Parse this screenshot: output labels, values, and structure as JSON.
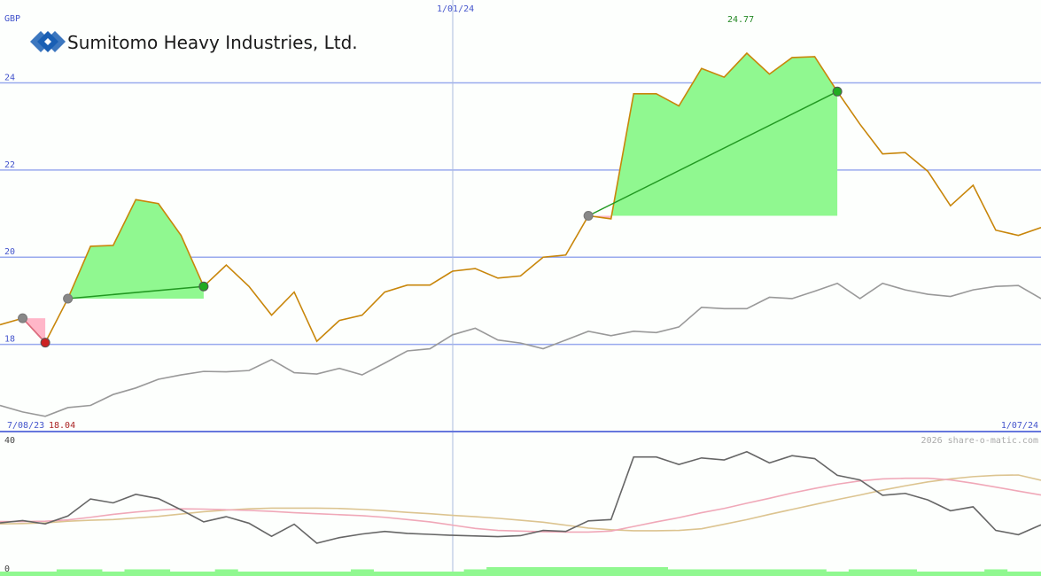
{
  "brand": {
    "name": "Sumitomo Heavy Industries, Ltd.",
    "logo_icon": "sumitomo-diamond-icon"
  },
  "labels": {
    "currency": "GBP",
    "date_start": "7/08/23",
    "date_mid": "1/01/24",
    "date_end": "1/07/24",
    "low_value": "18.04",
    "high_value": "24.77",
    "watermark": "2026 share-o-matic.com",
    "lower_top": "40",
    "lower_bottom": "0"
  },
  "colors": {
    "price": "#c8860a",
    "relative": "#999999",
    "gain_fill": "#90f890",
    "loss_fill": "#ffb6c8",
    "trend_line": "#229922",
    "grid": "#99aaee",
    "axis_text": "#4455cc",
    "high_text": "#228822",
    "low_text": "#aa2222",
    "osc_dark": "#666666",
    "osc_pink": "#f0a8b8",
    "osc_tan": "#dcc490",
    "volume": "#90f890"
  },
  "chart_data": {
    "type": "line",
    "title": "Sumitomo Heavy Industries, Ltd.",
    "ylabel": "GBP",
    "ylim": [
      16.0,
      25.9
    ],
    "yticks": [
      18,
      20,
      22,
      24
    ],
    "x_labels": [
      "7/08/23",
      "1/01/24",
      "1/07/24"
    ],
    "grid": true,
    "series": [
      {
        "name": "price",
        "values": [
          18.45,
          18.6,
          18.04,
          19.05,
          20.25,
          20.27,
          21.32,
          21.23,
          20.5,
          19.33,
          19.82,
          19.33,
          18.67,
          19.2,
          18.07,
          18.55,
          18.67,
          19.2,
          19.36,
          19.36,
          19.68,
          19.74,
          19.52,
          19.57,
          20.0,
          20.05,
          20.95,
          20.88,
          23.75,
          23.75,
          23.47,
          24.33,
          24.13,
          24.68,
          24.2,
          24.58,
          24.6,
          23.8,
          23.05,
          22.37,
          22.4,
          21.97,
          21.18,
          21.65,
          20.62,
          20.5,
          20.68
        ]
      },
      {
        "name": "relative",
        "values": [
          16.6,
          16.45,
          16.35,
          16.55,
          16.6,
          16.85,
          17.0,
          17.2,
          17.3,
          17.38,
          17.37,
          17.4,
          17.65,
          17.35,
          17.32,
          17.45,
          17.3,
          17.57,
          17.85,
          17.9,
          18.22,
          18.37,
          18.1,
          18.03,
          17.9,
          18.1,
          18.3,
          18.2,
          18.3,
          18.27,
          18.4,
          18.85,
          18.82,
          18.82,
          19.08,
          19.05,
          19.22,
          19.4,
          19.05,
          19.4,
          19.25,
          19.15,
          19.1,
          19.25,
          19.33,
          19.35,
          19.05
        ]
      }
    ],
    "annotations": {
      "low": 18.04,
      "high": 24.77,
      "trades": [
        {
          "buy": 18.6,
          "sell": 18.04,
          "result": "loss"
        },
        {
          "buy": 19.05,
          "sell": 19.33,
          "result": "gain"
        },
        {
          "buy": 20.95,
          "sell": 23.8,
          "result": "gain"
        }
      ]
    },
    "oscillator": {
      "ylim": [
        0,
        40
      ],
      "dark": [
        13.5,
        14.2,
        13.2,
        15.6,
        20.8,
        19.6,
        22.2,
        20.9,
        17.5,
        13.8,
        15.4,
        13.4,
        9.4,
        13.1,
        7.3,
        9.0,
        10.1,
        10.9,
        10.3,
        10.0,
        9.7,
        9.5,
        9.3,
        9.6,
        11.2,
        10.9,
        14.1,
        14.5,
        33.6,
        33.6,
        31.3,
        33.3,
        32.7,
        35.2,
        31.8,
        34.0,
        33.1,
        28.0,
        26.6,
        21.9,
        22.5,
        20.5,
        17.2,
        18.4,
        11.2,
        9.9,
        12.9
      ],
      "pink": [
        13.9,
        13.9,
        14.0,
        14.4,
        15.2,
        16.1,
        16.8,
        17.4,
        17.8,
        17.7,
        17.5,
        17.3,
        17.0,
        16.6,
        16.3,
        16.0,
        15.7,
        15.2,
        14.5,
        13.8,
        12.8,
        11.8,
        11.2,
        11.0,
        10.8,
        10.7,
        10.7,
        11.0,
        12.4,
        13.8,
        15.1,
        16.6,
        17.9,
        19.5,
        21.0,
        22.6,
        24.0,
        25.3,
        26.3,
        26.9,
        27.1,
        27.1,
        26.6,
        25.6,
        24.4,
        23.2,
        22.0
      ],
      "tan": [
        13.2,
        13.3,
        13.5,
        14.0,
        14.3,
        14.5,
        15.0,
        15.5,
        16.2,
        16.9,
        17.4,
        17.8,
        18.0,
        18.0,
        18.0,
        17.9,
        17.6,
        17.2,
        16.7,
        16.3,
        15.8,
        15.4,
        14.9,
        14.3,
        13.7,
        12.8,
        11.9,
        11.4,
        11.1,
        11.1,
        11.2,
        11.7,
        13.1,
        14.5,
        16.1,
        17.6,
        19.1,
        20.6,
        22.0,
        23.5,
        24.8,
        26.0,
        26.9,
        27.6,
        28.0,
        28.1,
        26.5
      ]
    },
    "volume": [
      2,
      2,
      2,
      3,
      3,
      2,
      3,
      3,
      2,
      2,
      3,
      2,
      2,
      2,
      2,
      2,
      3,
      2,
      2,
      2,
      2,
      3,
      4,
      4,
      4,
      4,
      4,
      4,
      4,
      4,
      3,
      3,
      3,
      3,
      3,
      3,
      3,
      2,
      3,
      3,
      3,
      2,
      2,
      2,
      3,
      2,
      2
    ]
  }
}
